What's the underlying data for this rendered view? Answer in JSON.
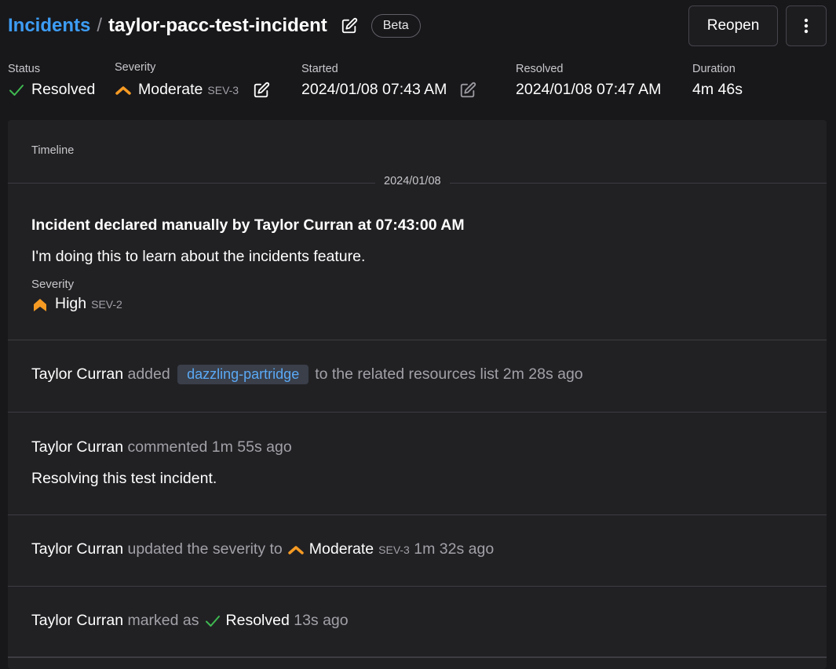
{
  "header": {
    "breadcrumb_link": "Incidents",
    "breadcrumb_sep": "/",
    "title": "taylor-pacc-test-incident",
    "badge": "Beta",
    "reopen_label": "Reopen",
    "more_label": "⋮"
  },
  "meta": {
    "status": {
      "label": "Status",
      "value": "Resolved"
    },
    "severity": {
      "label": "Severity",
      "value": "Moderate",
      "code": "SEV-3"
    },
    "started": {
      "label": "Started",
      "value": "2024/01/08 07:43 AM"
    },
    "resolved": {
      "label": "Resolved",
      "value": "2024/01/08 07:47 AM"
    },
    "duration": {
      "label": "Duration",
      "value": "4m 46s"
    }
  },
  "timeline": {
    "title": "Timeline",
    "date": "2024/01/08",
    "declared": {
      "heading": "Incident declared manually by Taylor Curran at 07:43:00 AM",
      "message": "I'm doing this to learn about the incidents feature.",
      "severity_label": "Severity",
      "severity_value": "High",
      "severity_code": "SEV-2"
    },
    "related": {
      "actor": "Taylor Curran",
      "verb": "added",
      "resource": "dazzling-partridge",
      "rest": "to the related resources list",
      "time": "2m 28s ago"
    },
    "comment": {
      "actor": "Taylor Curran",
      "verb": "commented",
      "time": "1m 55s ago",
      "text": "Resolving this test incident."
    },
    "severity_update": {
      "actor": "Taylor Curran",
      "verb": "updated the severity to",
      "value": "Moderate",
      "code": "SEV-3",
      "time": "1m 32s ago"
    },
    "resolved": {
      "actor": "Taylor Curran",
      "verb": "marked as",
      "value": "Resolved",
      "time": "13s ago"
    }
  },
  "colors": {
    "accent_link": "#3d9df5",
    "resolved_green": "#3fb950",
    "severity_orange": "#f59a23",
    "background": "#18181b",
    "panel": "#212124"
  },
  "icons": [
    "edit-icon",
    "check-icon",
    "chevron-up-icon",
    "double-chevron-up-icon",
    "more-vertical-icon"
  ]
}
